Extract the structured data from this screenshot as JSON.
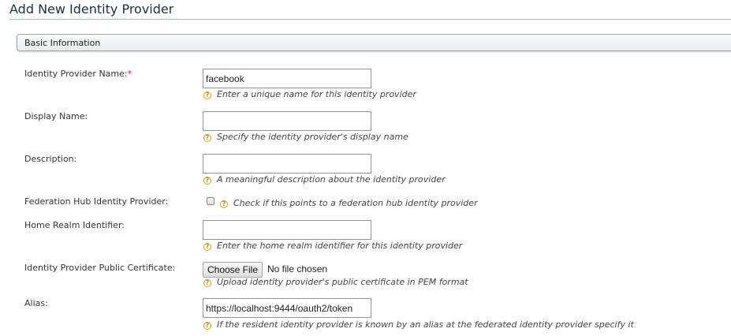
{
  "page": {
    "title": "Add New Identity Provider"
  },
  "section": {
    "title": "Basic Information"
  },
  "form": {
    "idp_name": {
      "label": "Identity Provider Name:",
      "required_mark": "*",
      "value": "facebook",
      "help": "Enter a unique name for this identity provider"
    },
    "display_name": {
      "label": "Display Name:",
      "value": "",
      "help": "Specify the identity provider's display name"
    },
    "description": {
      "label": "Description:",
      "value": "",
      "help": "A meaningful description about the identity provider"
    },
    "federation_hub": {
      "label": "Federation Hub Identity Provider:",
      "checked": false,
      "help": "Check if this points to a federation hub identity provider"
    },
    "home_realm": {
      "label": "Home Realm Identifier:",
      "value": "",
      "help": "Enter the home realm identifier for this identity provider"
    },
    "public_cert": {
      "label": "Identity Provider Public Certificate:",
      "button_label": "Choose File",
      "file_status": "No file chosen",
      "help": "Upload identity provider's public certificate in PEM format"
    },
    "alias": {
      "label": "Alias:",
      "value": "https://localhost:9444/oauth2/token",
      "help": "If the resident identity provider is known by an alias at the federated identity provider specify it"
    }
  },
  "icons": {
    "help": "question-circle-icon",
    "help_glyph": "?"
  },
  "colors": {
    "required": "#d41f1f",
    "help_icon": "#d69c1e"
  }
}
